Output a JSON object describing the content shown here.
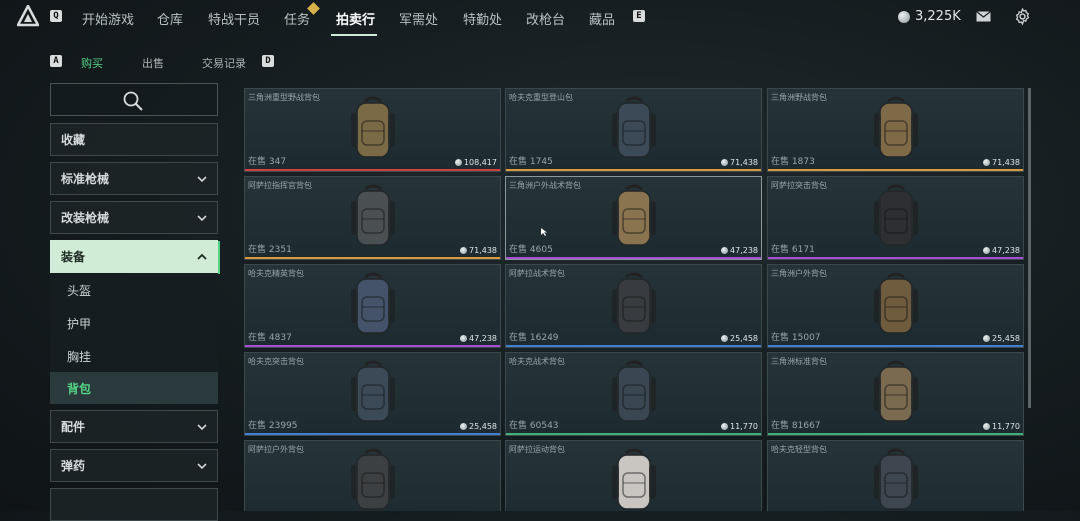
{
  "nav": {
    "left_key": "Q",
    "items": [
      "开始游戏",
      "仓库",
      "特战干员",
      "任务",
      "拍卖行",
      "军需处",
      "特勤处",
      "改枪台",
      "藏品"
    ],
    "active_index": 4,
    "right_key": "E",
    "currency": "3,225K"
  },
  "subtabs": {
    "left_key": "A",
    "items": [
      "购买",
      "出售",
      "交易记录"
    ],
    "active_index": 0,
    "right_key": "D"
  },
  "sidebar": {
    "categories": [
      "收藏",
      "标准枪械",
      "改装枪械",
      "装备",
      "配件",
      "弹药"
    ],
    "open_category": "装备",
    "sub_items": [
      "头盔",
      "护甲",
      "胸挂",
      "背包"
    ],
    "active_sub": "背包"
  },
  "stock_prefix": "在售",
  "items": [
    {
      "name": "三角洲重型野战背包",
      "stock": "347",
      "price": "108,417",
      "rarity": "#d04040",
      "bag": "#7a6a45"
    },
    {
      "name": "哈夫克重型登山包",
      "stock": "1745",
      "price": "71,438",
      "rarity": "#d89a3a",
      "bag": "#3c4a58"
    },
    {
      "name": "三角洲野战背包",
      "stock": "1873",
      "price": "71,438",
      "rarity": "#d89a3a",
      "bag": "#7f6a48"
    },
    {
      "name": "阿萨拉指挥官背包",
      "stock": "2351",
      "price": "71,438",
      "rarity": "#d89a3a",
      "bag": "#4a4f52"
    },
    {
      "name": "三角洲户外战术背包",
      "stock": "4605",
      "price": "47,238",
      "rarity": "#a64fd6",
      "bag": "#8a7450"
    },
    {
      "name": "阿萨拉突击背包",
      "stock": "6171",
      "price": "47,238",
      "rarity": "#a64fd6",
      "bag": "#2d2f33"
    },
    {
      "name": "哈夫克精英背包",
      "stock": "4837",
      "price": "47,238",
      "rarity": "#a64fd6",
      "bag": "#44536a"
    },
    {
      "name": "阿萨拉战术背包",
      "stock": "16249",
      "price": "25,458",
      "rarity": "#3f7fd0",
      "bag": "#383c40"
    },
    {
      "name": "三角洲户外背包",
      "stock": "15007",
      "price": "25,458",
      "rarity": "#3f7fd0",
      "bag": "#6f5c3e"
    },
    {
      "name": "哈夫克突击背包",
      "stock": "23995",
      "price": "25,458",
      "rarity": "#3f7fd0",
      "bag": "#3c4a58"
    },
    {
      "name": "哈夫克战术背包",
      "stock": "60543",
      "price": "11,770",
      "rarity": "#3fb07a",
      "bag": "#3a4652"
    },
    {
      "name": "三角洲标准背包",
      "stock": "81667",
      "price": "11,770",
      "rarity": "#3fb07a",
      "bag": "#7a6a4f"
    },
    {
      "name": "阿萨拉户外背包",
      "stock": "",
      "price": "",
      "rarity": "#3fb07a",
      "bag": "#3d4042"
    },
    {
      "name": "阿萨拉运动背包",
      "stock": "",
      "price": "",
      "rarity": "#3fb07a",
      "bag": "#c9c6c2"
    },
    {
      "name": "哈夫克轻型背包",
      "stock": "",
      "price": "",
      "rarity": "#3fb07a",
      "bag": "#3e4750"
    }
  ],
  "selected_item_index": 4
}
